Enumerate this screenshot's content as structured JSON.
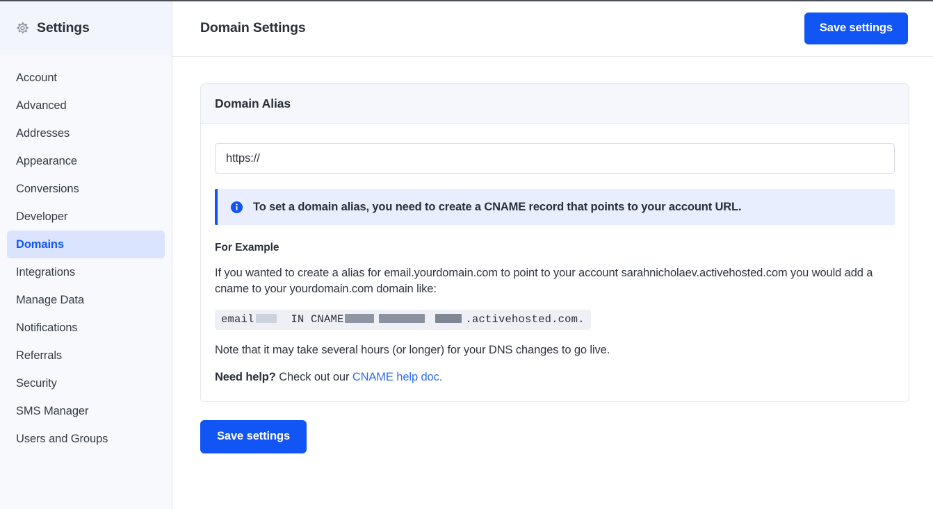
{
  "theme": {
    "accent": "#1155f5",
    "link": "#2f6bf0",
    "sidebar_bg": "#f7f9fc",
    "active_item_bg": "#dbe4fe",
    "card_header_bg": "#f5f7fc",
    "info_banner_bg": "#e8eefd",
    "code_block_bg": "#eef0f5",
    "text": "#2b2f38"
  },
  "sidebar": {
    "icon": "gear-icon",
    "title": "Settings",
    "items": [
      {
        "label": "Account",
        "active": false
      },
      {
        "label": "Advanced",
        "active": false
      },
      {
        "label": "Addresses",
        "active": false
      },
      {
        "label": "Appearance",
        "active": false
      },
      {
        "label": "Conversions",
        "active": false
      },
      {
        "label": "Developer",
        "active": false
      },
      {
        "label": "Domains",
        "active": true
      },
      {
        "label": "Integrations",
        "active": false
      },
      {
        "label": "Manage Data",
        "active": false
      },
      {
        "label": "Notifications",
        "active": false
      },
      {
        "label": "Referrals",
        "active": false
      },
      {
        "label": "Security",
        "active": false
      },
      {
        "label": "SMS Manager",
        "active": false
      },
      {
        "label": "Users and Groups",
        "active": false
      }
    ]
  },
  "header": {
    "title": "Domain Settings",
    "save_label": "Save settings"
  },
  "card": {
    "title": "Domain Alias",
    "alias_input": {
      "value": "https://",
      "placeholder": "https://"
    },
    "info_banner": {
      "icon": "info-circle-icon",
      "text": "To set a domain alias, you need to create a CNAME record that points to your account URL."
    },
    "example": {
      "heading": "For Example",
      "paragraph": "If you wanted to create a alias for email.yourdomain.com to point to your account sarahnicholaev.activehosted.com you would add a cname to your yourdomain.com domain like:",
      "code": {
        "part1": "email",
        "part2": "IN CNAME",
        "part3": ".activehosted.com.",
        "redacted_count": 4
      }
    },
    "note": "Note that it may take several hours (or longer) for your DNS changes to go live.",
    "help": {
      "prefix_bold": "Need help?",
      "text": " Check out our ",
      "link_label": "CNAME help doc."
    }
  },
  "footer": {
    "save_label": "Save settings"
  }
}
